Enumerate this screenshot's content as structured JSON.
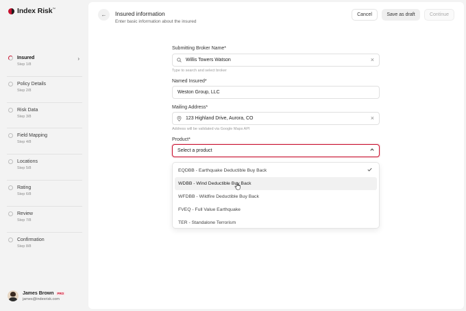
{
  "app": {
    "logo_text": "Index Risk",
    "logo_tm": "™"
  },
  "steps": [
    {
      "title": "Insured",
      "sub": "Step 1/8",
      "active": true
    },
    {
      "title": "Policy Details",
      "sub": "Step 2/8"
    },
    {
      "title": "Risk Data",
      "sub": "Step 3/8"
    },
    {
      "title": "Field Mapping",
      "sub": "Step 4/8"
    },
    {
      "title": "Locations",
      "sub": "Step 5/8"
    },
    {
      "title": "Rating",
      "sub": "Step 6/8"
    },
    {
      "title": "Review",
      "sub": "Step 7/8"
    },
    {
      "title": "Confirmation",
      "sub": "Step 8/8"
    }
  ],
  "user": {
    "name": "James Brown",
    "badge": "PRO",
    "email": "james@indexrisk.com"
  },
  "header": {
    "title": "Insured information",
    "subtitle": "Enter basic information about the insured",
    "back_icon": "←"
  },
  "actions": {
    "cancel": "Cancel",
    "save_draft": "Save as draft",
    "continue": "Continue"
  },
  "form": {
    "broker": {
      "label": "Submitting Broker Name*",
      "value": "Willis Towers Watson",
      "hint": "Type to search and select broker"
    },
    "insured": {
      "label": "Named Insured*",
      "value": "Weston Group, LLC"
    },
    "address": {
      "label": "Mailing Address*",
      "value": "123 Highland Drive, Aurora, CO",
      "hint": "Address will be validated via Google Maps API"
    },
    "product": {
      "label": "Product*",
      "placeholder": "Select a product"
    }
  },
  "product_options": [
    {
      "label": "EQDBB - Earthquake Deductible Buy Back",
      "checked": true
    },
    {
      "label": "WDBB - Wind Deductible Buy Back",
      "hover": true
    },
    {
      "label": "WFDBB - Wildfire Deductible Buy Back"
    },
    {
      "label": "FVEQ - Full Value Earthquake"
    },
    {
      "label": "TER - Standalone Terrorism"
    }
  ],
  "colors": {
    "accent": "#c8102e",
    "background": "#f3f3f3",
    "panel": "#ffffff"
  }
}
